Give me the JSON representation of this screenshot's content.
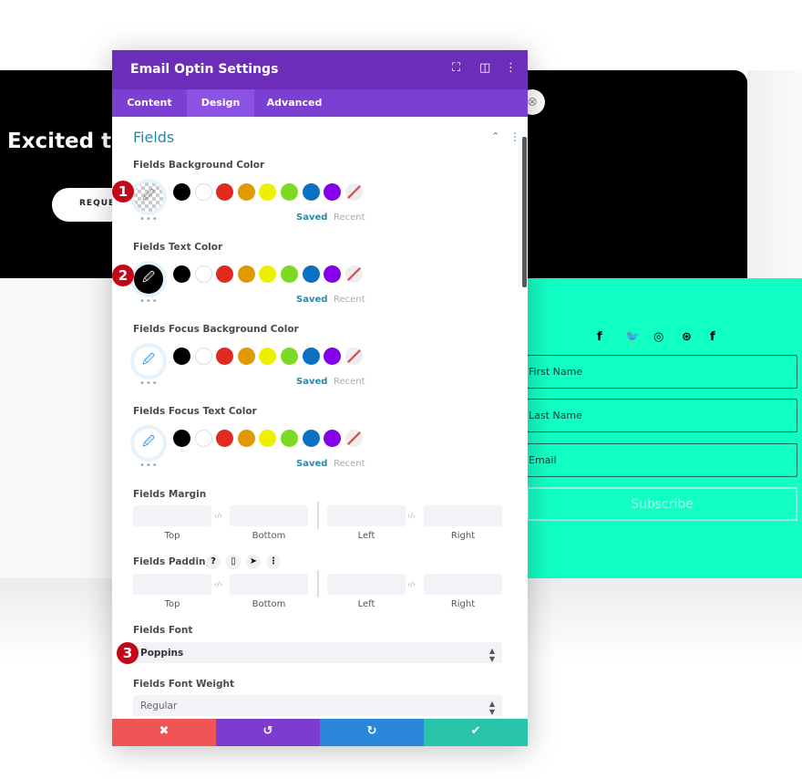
{
  "page": {
    "hero_title": "Excited to",
    "request_button": "REQUES",
    "social_icons": [
      "facebook-icon",
      "twitter-icon",
      "instagram-icon",
      "dribbble-icon",
      "facebook-icon"
    ],
    "social_glyphs": [
      "f",
      "🐦",
      "◎",
      "⊛",
      "f"
    ],
    "fields": [
      "First Name",
      "Last Name",
      "Email"
    ],
    "subscribe": "Subscribe",
    "teal": "#12ffc4"
  },
  "modal": {
    "title": "Email Optin Settings",
    "tabs": [
      "Content",
      "Design",
      "Advanced"
    ],
    "active_tab": "Design",
    "section": "Fields",
    "swatches": [
      "#000000",
      "#ffffff",
      "#e02b20",
      "#e09900",
      "#edf000",
      "#7cda24",
      "#0c71c3",
      "#8300e9",
      "none"
    ],
    "color_settings": [
      {
        "label": "Fields Background Color",
        "picker": "transparent",
        "badge": "1"
      },
      {
        "label": "Fields Text Color",
        "picker": "#000000",
        "badge": "2"
      },
      {
        "label": "Fields Focus Background Color",
        "picker": "eyedropper"
      },
      {
        "label": "Fields Focus Text Color",
        "picker": "eyedropper"
      }
    ],
    "saved": "Saved",
    "recent": "Recent",
    "margin_label": "Fields Margin",
    "padding_label": "Fields Padding",
    "sides": [
      "Top",
      "Bottom",
      "Left",
      "Right"
    ],
    "font_label": "Fields Font",
    "font_value": "Poppins",
    "font_badge": "3",
    "weight_label": "Fields Font Weight",
    "weight_value": "Regular",
    "footer": {
      "cancel": "✖",
      "undo": "↺",
      "redo": "↻",
      "save": "✔",
      "colors": [
        "#ef5555",
        "#7d3bcf",
        "#2b87da",
        "#29c4a9"
      ]
    }
  }
}
